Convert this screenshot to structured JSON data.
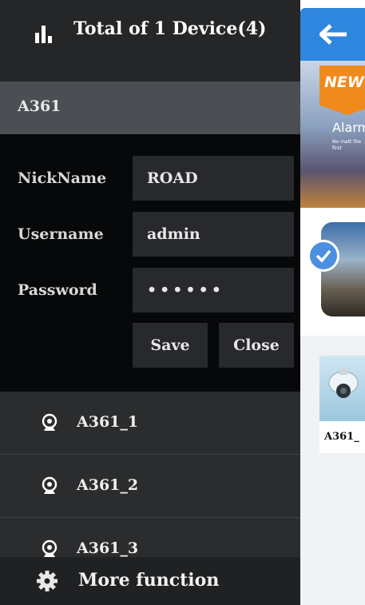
{
  "drawer": {
    "title": "Total of 1 Device(4)",
    "device_name": "A361",
    "form": {
      "nickname_label": "NickName",
      "nickname_value": "ROAD",
      "username_label": "Username",
      "username_value": "admin",
      "password_label": "Password",
      "password_value": "••••••",
      "save_label": "Save",
      "close_label": "Close"
    },
    "channels": [
      {
        "label": "A361_1"
      },
      {
        "label": "A361_2"
      },
      {
        "label": "A361_3"
      }
    ],
    "more_label": "More function"
  },
  "background_app": {
    "banner_badge": "NEW",
    "banner_title": "Alarm",
    "banner_subtitle": "No matt the first",
    "camera_label": "A361_"
  },
  "colors": {
    "drawer_bg": "#2a2c2e",
    "form_bg": "#070809",
    "app_bar": "#2e86de",
    "accent_orange": "#f08a1c"
  }
}
